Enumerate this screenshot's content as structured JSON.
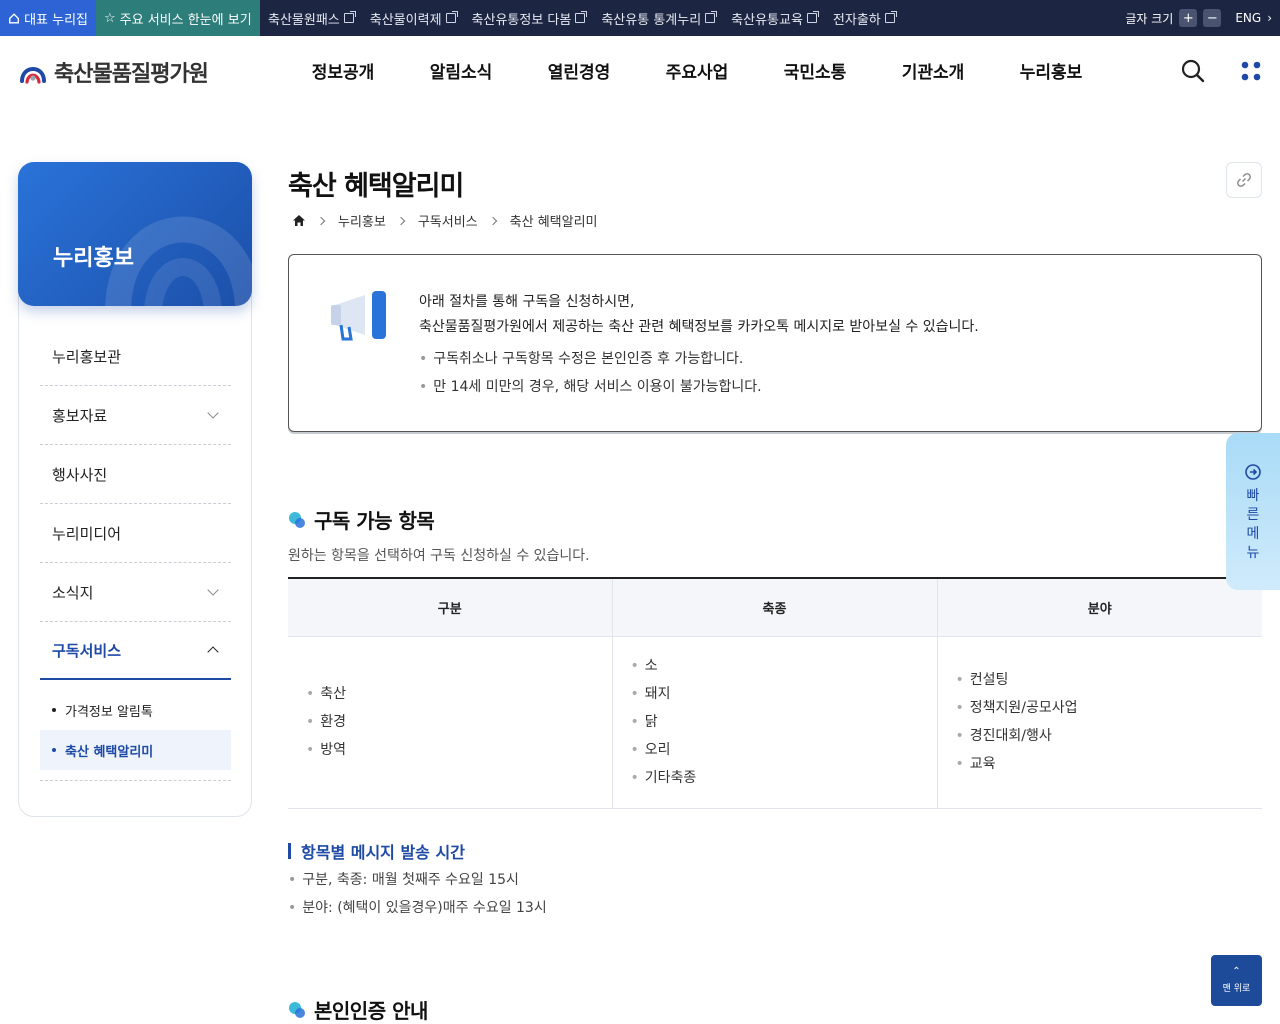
{
  "topbar": {
    "rep_portal": "대표 누리집",
    "main_services": "주요 서비스 한눈에 보기",
    "links": [
      "축산물원패스",
      "축산물이력제",
      "축산유통정보 다봄",
      "축산유통 통계누리",
      "축산유통교육",
      "전자출하"
    ],
    "font_size_label": "글자 크기",
    "plus": "+",
    "minus": "−",
    "lang": "ENG"
  },
  "header": {
    "logo_text": "축산물품질평가원",
    "gnb": [
      "정보공개",
      "알림소식",
      "열린경영",
      "주요사업",
      "국민소통",
      "기관소개",
      "누리홍보"
    ]
  },
  "sidebar": {
    "title": "누리홍보",
    "items": [
      {
        "label": "누리홍보관"
      },
      {
        "label": "홍보자료"
      },
      {
        "label": "행사사진"
      },
      {
        "label": "누리미디어"
      },
      {
        "label": "소식지"
      },
      {
        "label": "구독서비스"
      }
    ],
    "sub_items": [
      {
        "label": "가격정보 알림톡"
      },
      {
        "label": "축산 혜택알리미"
      }
    ]
  },
  "page": {
    "title": "축산 혜택알리미",
    "breadcrumb": [
      "누리홍보",
      "구독서비스",
      "축산 혜택알리미"
    ]
  },
  "notice": {
    "line1": "아래 절차를 통해 구독을 신청하시면,",
    "line2": "축산물품질평가원에서 제공하는 축산 관련 혜택정보를 카카오톡 메시지로 받아보실 수 있습니다.",
    "bullets": [
      "구독취소나 구독항목 수정은 본인인증 후 가능합니다.",
      "만 14세 미만의 경우, 해당 서비스 이용이 불가능합니다."
    ]
  },
  "section1": {
    "title": "구독 가능 항목",
    "desc": "원하는 항목을 선택하여 구독 신청하실 수 있습니다.",
    "headers": [
      "구분",
      "축종",
      "분야"
    ],
    "col1": [
      "축산",
      "환경",
      "방역"
    ],
    "col2": [
      "소",
      "돼지",
      "닭",
      "오리",
      "기타축종"
    ],
    "col3": [
      "컨설팅",
      "정책지원/공모사업",
      "경진대회/행사",
      "교육"
    ]
  },
  "schedule": {
    "title": "항목별 메시지 발송 시간",
    "items": [
      "구분, 축종: 매월 첫째주 수요일 15시",
      "분야: (혜택이 있을경우)매주 수요일 13시"
    ]
  },
  "section2": {
    "title": "본인인증 안내"
  },
  "quick_menu": {
    "label": "빠른메뉴",
    "chars": [
      "빠",
      "른",
      "메",
      "뉴"
    ]
  },
  "to_top": {
    "label": "맨 위로"
  },
  "colors": {
    "topbar": "#1c2541",
    "primary": "#1e4aa6",
    "green": "#2d7d7a",
    "blue": "#2d63d4"
  }
}
